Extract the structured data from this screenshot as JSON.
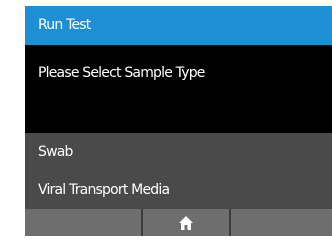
{
  "screen": {
    "title": "Run Test",
    "prompt": "Please Select Sample Type"
  },
  "options": [
    {
      "label": "Swab"
    },
    {
      "label": "Viral Transport Media"
    }
  ],
  "navbar": {
    "home_icon": "home-icon"
  },
  "colors": {
    "title_bar": "#1e8fd5",
    "screen_background": "#000000",
    "options_background": "#4a4a4a",
    "navbar_button": "#6e6e6e",
    "text": "#ffffff"
  }
}
